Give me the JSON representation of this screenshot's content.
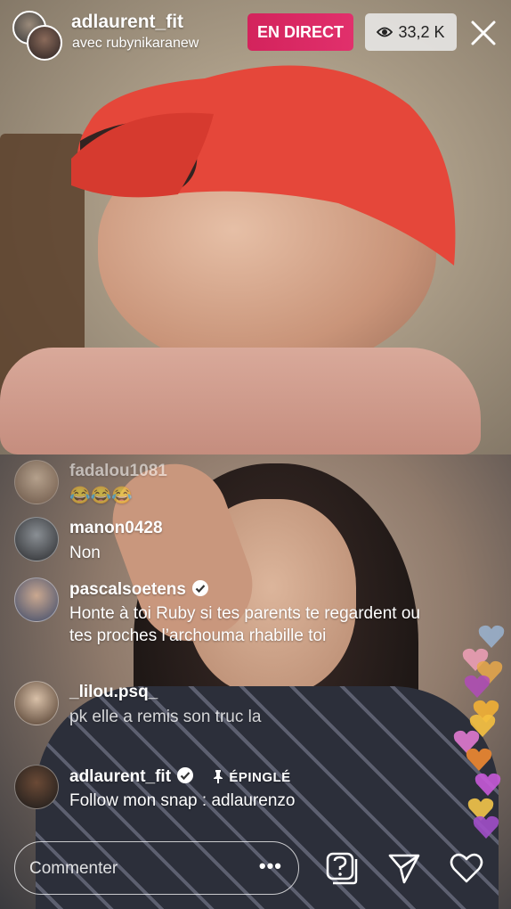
{
  "header": {
    "host_username": "adlaurent_fit",
    "guest_line": "avec rubynikaranew",
    "live_label": "EN DIRECT",
    "viewer_count": "33,2 K",
    "icons": {
      "viewers": "eye-icon",
      "close": "close-icon"
    }
  },
  "comments": [
    {
      "username": "fadalou1081",
      "text": "😂😂😂",
      "faded": true
    },
    {
      "username": "manon0428",
      "text": "Non"
    },
    {
      "username": "pascalsoetens",
      "verified": true,
      "text": "Honte à toi Ruby si tes parents te regardent ou tes proches l’archouma rhabille toi"
    },
    {
      "username": "_lilou.psq_",
      "text": "pk elle a remis son truc la"
    },
    {
      "username": "adlaurent_fit",
      "verified": true,
      "pinned_label": "ÉPINGLÉ",
      "text": "Follow mon snap : adlaurenzo"
    }
  ],
  "footer": {
    "comment_placeholder": "Commenter",
    "more_label": "•••",
    "icons": {
      "question": "question-box-icon",
      "send": "send-icon",
      "like": "heart-icon"
    }
  },
  "colors": {
    "live_badge": "#e1306c",
    "viewer_badge": "#ebebeb"
  }
}
